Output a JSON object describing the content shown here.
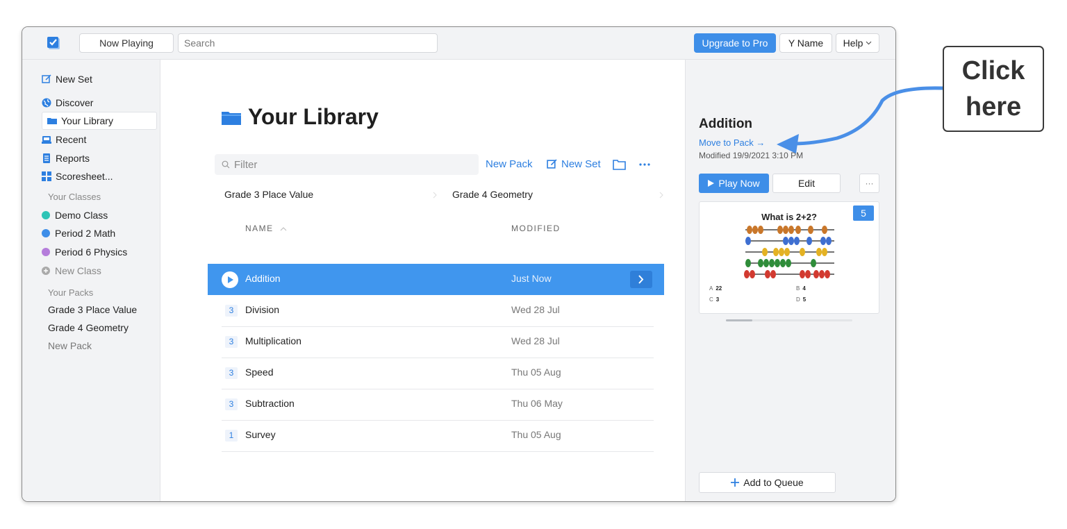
{
  "toolbar": {
    "now_playing": "Now Playing",
    "search_placeholder": "Search",
    "upgrade": "Upgrade to Pro",
    "user": "Y Name",
    "help": "Help"
  },
  "sidebar": {
    "new_set": "New Set",
    "discover": "Discover",
    "your_library": "Your Library",
    "recent": "Recent",
    "reports": "Reports",
    "scoresheet": "Scoresheet...",
    "classes_heading": "Your Classes",
    "classes": [
      {
        "label": "Demo Class",
        "color": "#2ec4b6"
      },
      {
        "label": "Period 2 Math",
        "color": "#3e8ee8"
      },
      {
        "label": "Period 6 Physics",
        "color": "#b57ddb"
      }
    ],
    "new_class": "New Class",
    "packs_heading": "Your Packs",
    "packs": [
      "Grade 3 Place Value",
      "Grade 4 Geometry"
    ],
    "new_pack": "New Pack"
  },
  "main": {
    "title": "Your Library",
    "filter_placeholder": "Filter",
    "new_pack": "New Pack",
    "new_set": "New Set",
    "pack_tabs": [
      "Grade 3 Place Value",
      "Grade 4 Geometry"
    ],
    "col_name": "NAME",
    "col_modified": "MODIFIED",
    "rows": [
      {
        "count": "",
        "name": "Addition",
        "modified": "Just Now"
      },
      {
        "count": "3",
        "name": "Division",
        "modified": "Wed 28 Jul"
      },
      {
        "count": "3",
        "name": "Multiplication",
        "modified": "Wed 28 Jul"
      },
      {
        "count": "3",
        "name": "Speed",
        "modified": "Thu 05 Aug"
      },
      {
        "count": "3",
        "name": "Subtraction",
        "modified": "Thu 06 May"
      },
      {
        "count": "1",
        "name": "Survey",
        "modified": "Thu 05 Aug"
      }
    ]
  },
  "panel": {
    "title": "Addition",
    "move_to_pack": "Move to Pack →",
    "modified": "Modified 19/9/2021 3:10 PM",
    "play_now": "Play Now",
    "edit": "Edit",
    "more": "···",
    "card": {
      "question": "What is 2+2?",
      "number": "5",
      "answers": [
        {
          "key": "A",
          "value": "22"
        },
        {
          "key": "B",
          "value": "4"
        },
        {
          "key": "C",
          "value": "3"
        },
        {
          "key": "D",
          "value": "5"
        }
      ]
    },
    "add_to_queue": "Add to Queue"
  },
  "callout": {
    "line1": "Click",
    "line2": "here"
  },
  "colors": {
    "accent": "#3e8ee8",
    "selected_row": "#4096ee",
    "link": "#2d7fe0"
  }
}
